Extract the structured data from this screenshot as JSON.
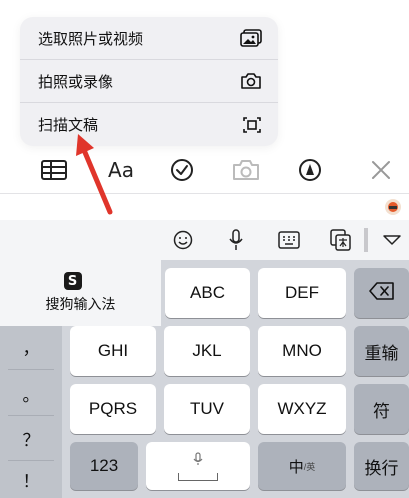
{
  "menu": {
    "items": [
      {
        "label": "选取照片或视频",
        "icon": "photo-library-icon"
      },
      {
        "label": "拍照或录像",
        "icon": "camera-icon"
      },
      {
        "label": "扫描文稿",
        "icon": "scan-document-icon"
      }
    ]
  },
  "toolbar": {
    "format_label": "Aa",
    "icons": [
      "table-icon",
      "format-text-icon",
      "checklist-icon",
      "camera-icon",
      "markup-pen-icon",
      "close-icon"
    ]
  },
  "keyboard": {
    "top_icons": [
      "emoji-icon",
      "microphone-icon",
      "keyboard-icon",
      "clipboard-translate-icon",
      "collapse-chevron-icon"
    ],
    "brand": {
      "name": "搜狗输入法",
      "logo_letter": "S"
    },
    "side": [
      "，",
      "。",
      "？",
      "！"
    ],
    "row1": [
      "ABC",
      "DEF"
    ],
    "row2": [
      "GHI",
      "JKL",
      "MNO"
    ],
    "row2_action": "重输",
    "row3": [
      "PQRS",
      "TUV",
      "WXYZ"
    ],
    "row3_action": "符",
    "bottom": {
      "numbers": "123",
      "lang_main": "中",
      "lang_sub": "/英",
      "enter": "换行"
    }
  },
  "colors": {
    "arrow": "#e0352b",
    "keyboard_bg": "#d2d5db",
    "key": "#ffffff",
    "key_dark": "#adb2bb"
  }
}
